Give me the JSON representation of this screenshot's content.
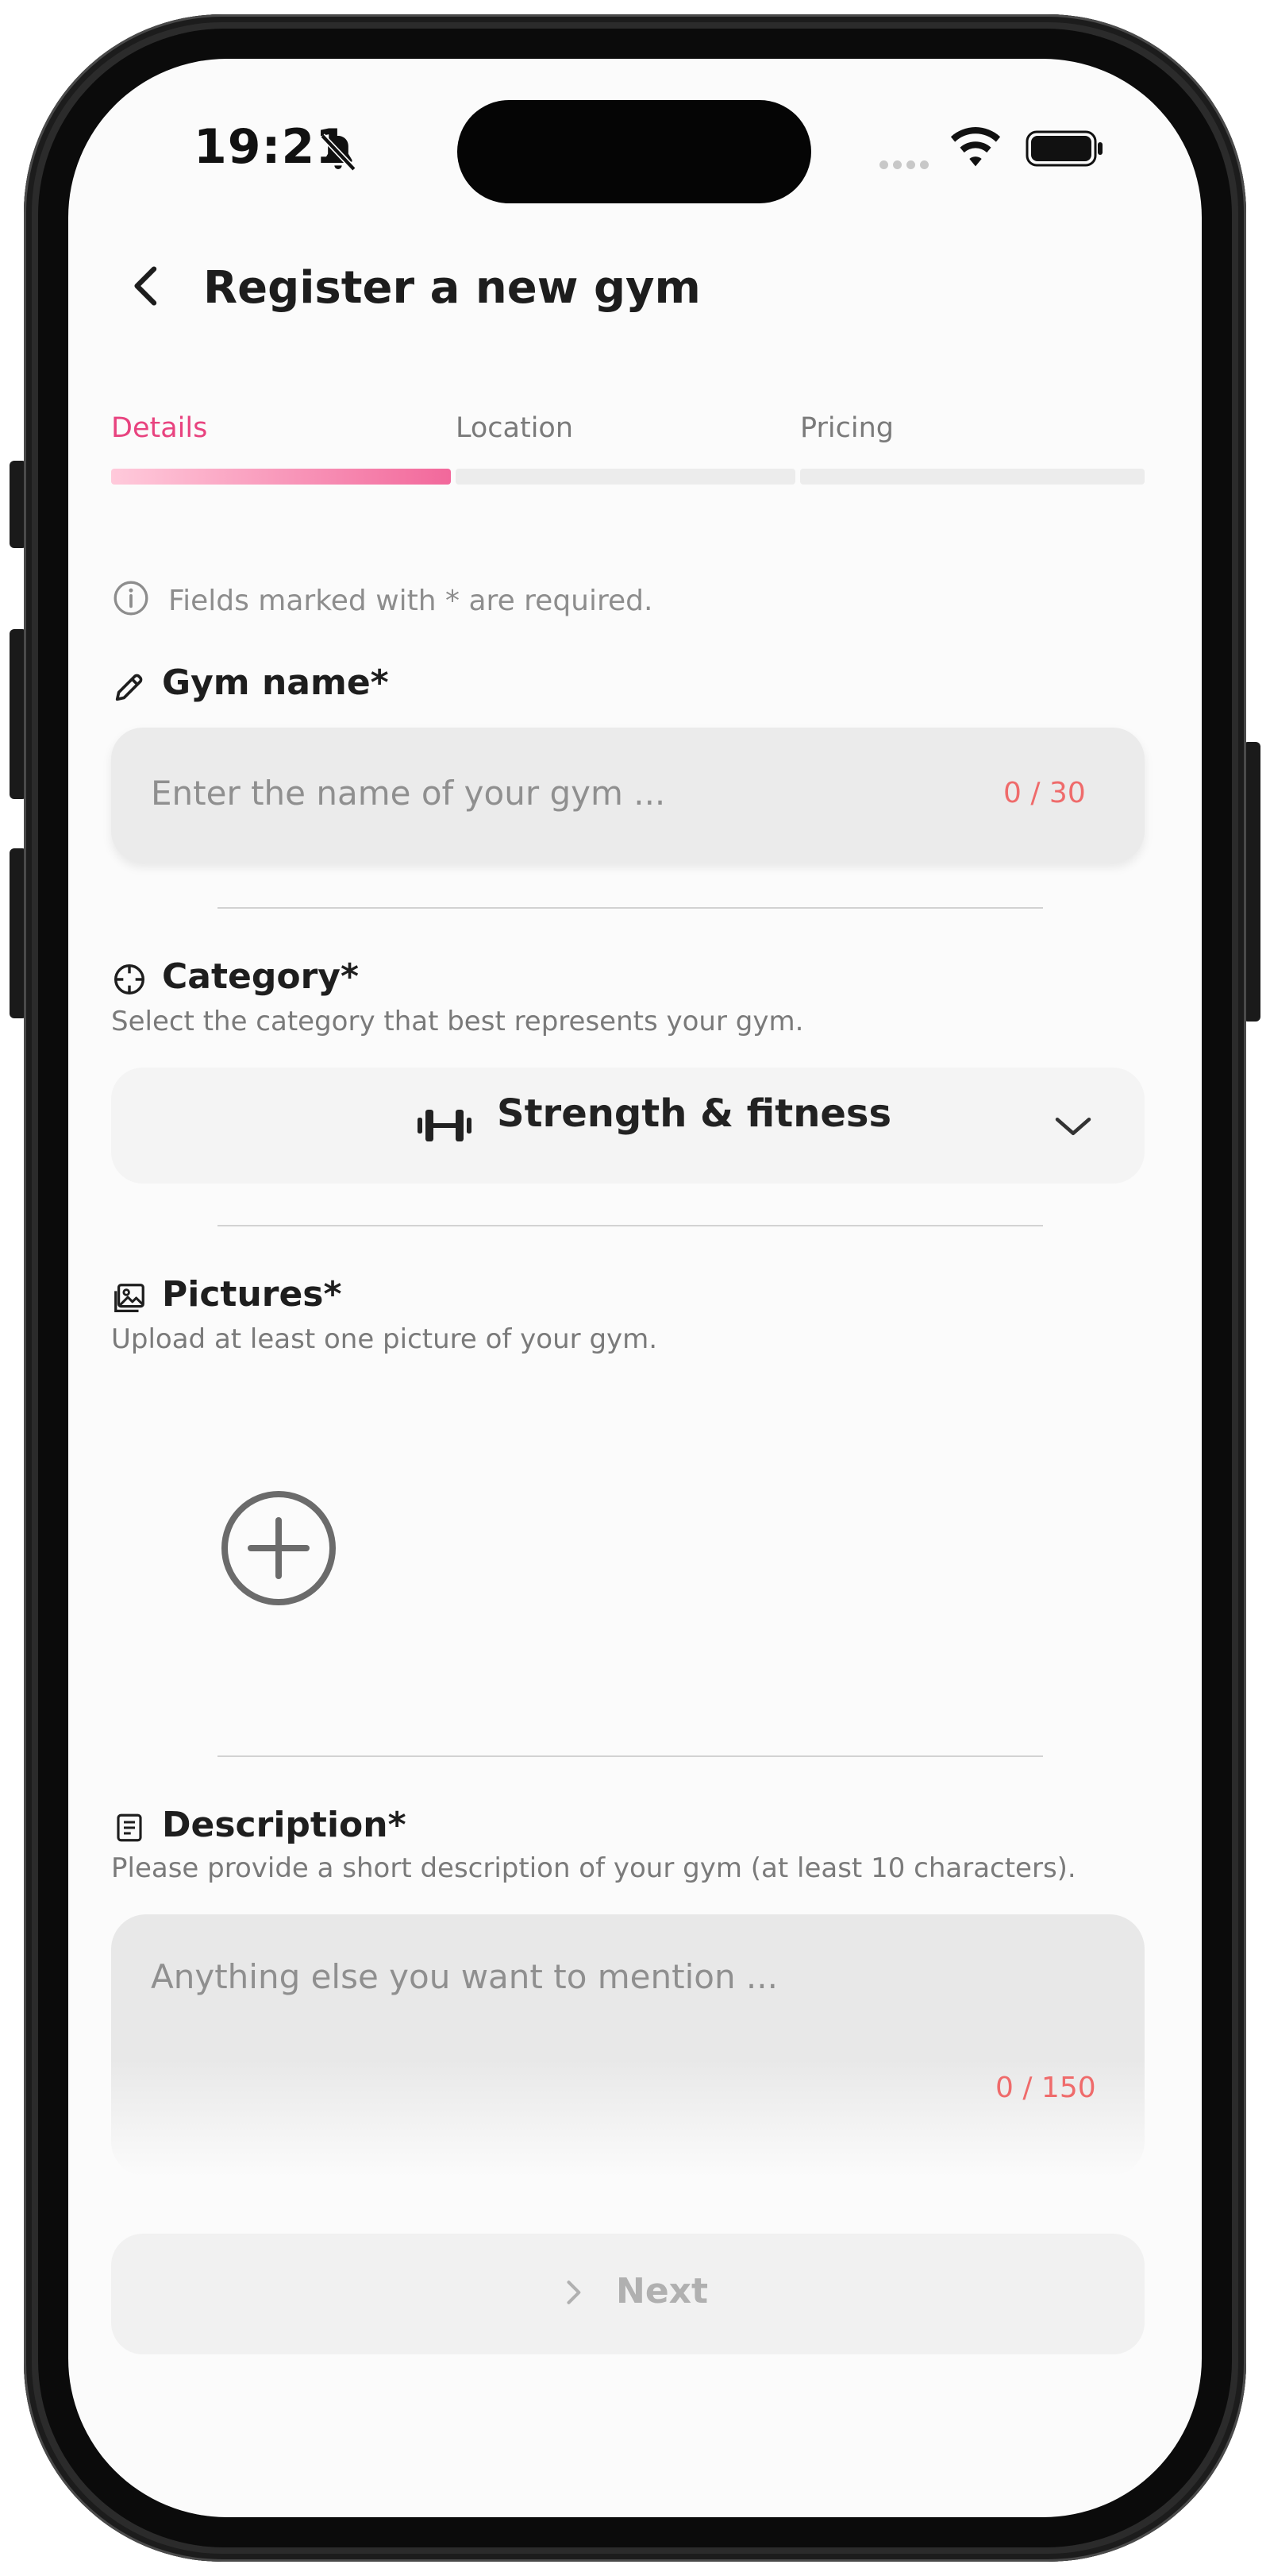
{
  "status_bar": {
    "time": "19:21"
  },
  "header": {
    "title": "Register a new gym"
  },
  "tabs": [
    {
      "label": "Details",
      "active": true
    },
    {
      "label": "Location",
      "active": false
    },
    {
      "label": "Pricing",
      "active": false
    }
  ],
  "progress": {
    "steps_total": 3,
    "current_step": 1
  },
  "info_note": "Fields marked with * are required.",
  "gym_name": {
    "label": "Gym name*",
    "placeholder": "Enter the name of your gym ...",
    "counter": "0 / 30"
  },
  "category": {
    "label": "Category*",
    "description": "Select the category that best represents your gym.",
    "selected": "Strength & fitness"
  },
  "pictures": {
    "label": "Pictures*",
    "description": "Upload at least one picture of your gym."
  },
  "description_field": {
    "label": "Description*",
    "description": "Please provide a short description of your gym (at least 10 characters).",
    "placeholder": "Anything else you want to mention ...",
    "counter": "0 / 150"
  },
  "footer": {
    "next_label": "Next"
  },
  "colors": {
    "accent": "#e8437f",
    "accent_light": "#ffc6d8",
    "counter": "#ef6b6b",
    "screen_bg": "#fbfbfb"
  },
  "icons": [
    "bell-slash-icon",
    "wifi-icon",
    "battery-icon",
    "back-arrow-icon",
    "info-icon",
    "pencil-icon",
    "crosshair-icon",
    "dumbbell-icon",
    "chevron-down-icon",
    "image-icon",
    "add-circle-icon",
    "document-icon",
    "chevron-right-icon"
  ]
}
